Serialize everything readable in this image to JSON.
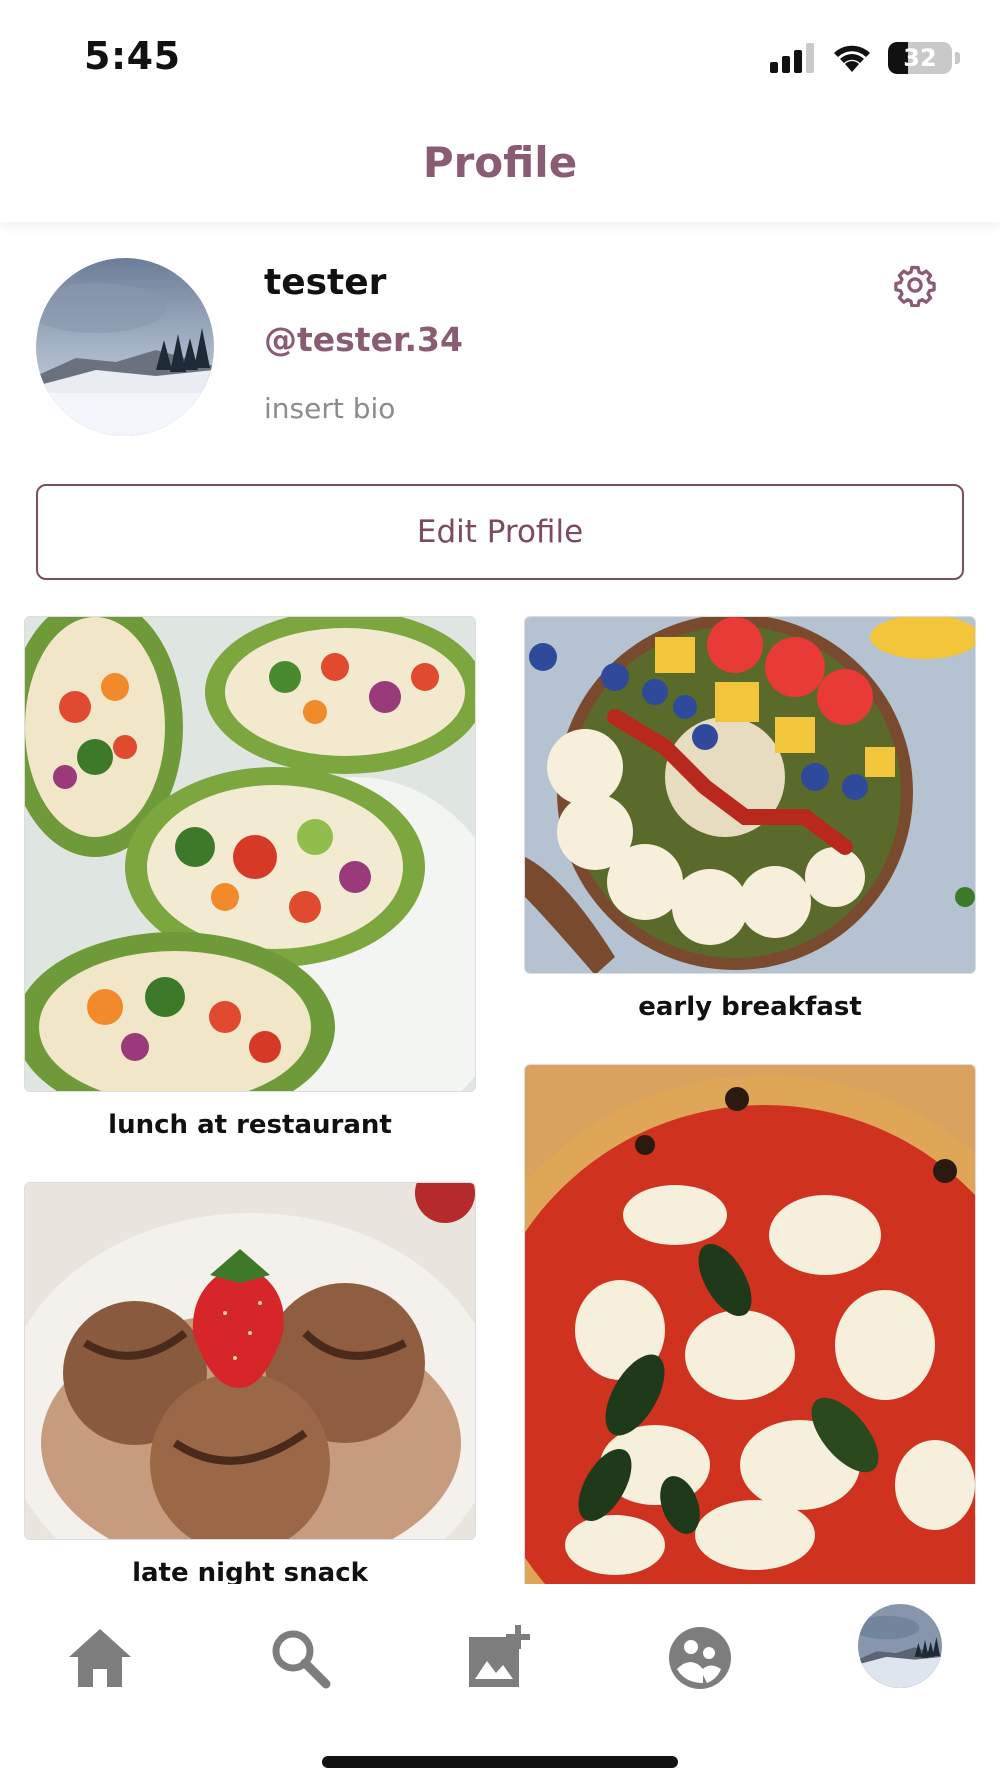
{
  "status_bar": {
    "time": "5:45",
    "battery_level": "32",
    "battery_fraction": 0.32
  },
  "header": {
    "title": "Profile"
  },
  "profile": {
    "display_name": "tester",
    "username": "@tester.34",
    "bio": "insert bio",
    "edit_button_label": "Edit Profile"
  },
  "posts": [
    {
      "caption": "lunch at restaurant"
    },
    {
      "caption": "early breakfast"
    },
    {
      "caption": "late night snack"
    },
    {
      "caption": ""
    }
  ],
  "nav": {
    "items": [
      "home-icon",
      "search-icon",
      "add-photo-icon",
      "friends-icon",
      "profile-avatar"
    ]
  },
  "colors": {
    "accent": "#8a5c74",
    "button_border": "#7a4b62",
    "icon_gray": "#7d7d7d"
  }
}
